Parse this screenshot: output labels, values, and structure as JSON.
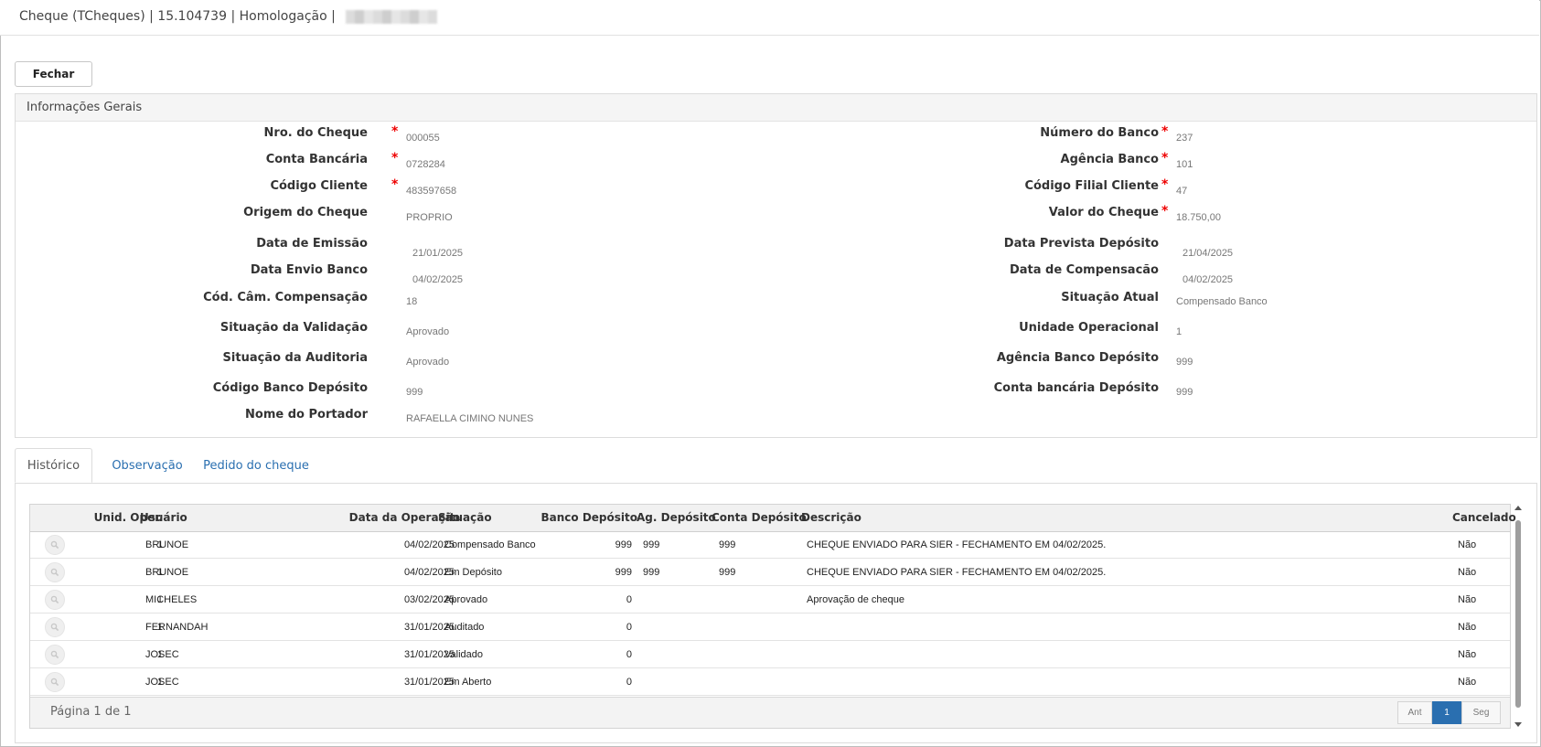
{
  "window": {
    "title": "Cheque (TCheques) | 15.104739 | Homologação |"
  },
  "toolbar": {
    "close_label": "Fechar"
  },
  "general": {
    "section_title": "Informações Gerais",
    "fields": {
      "nro_cheque": {
        "label": "Nro. do Cheque",
        "value": "000055",
        "required": true
      },
      "numero_banco": {
        "label": "Número do Banco",
        "value": "237",
        "required": true
      },
      "conta_bancaria": {
        "label": "Conta Bancária",
        "value": "0728284",
        "required": true
      },
      "agencia_banco": {
        "label": "Agência Banco",
        "value": "101",
        "required": true
      },
      "codigo_cliente": {
        "label": "Código Cliente",
        "value": "483597658",
        "required": true
      },
      "codigo_filial_cliente": {
        "label": "Código Filial Cliente",
        "value": "47",
        "required": true
      },
      "origem_cheque": {
        "label": "Origem do Cheque",
        "value": "PROPRIO"
      },
      "valor_cheque": {
        "label": "Valor do Cheque",
        "value": "18.750,00",
        "required": true
      },
      "data_emissao": {
        "label": "Data de Emissão",
        "value": "21/01/2025"
      },
      "data_prevista_deposito": {
        "label": "Data Prevista Depósito",
        "value": "21/04/2025"
      },
      "data_envio_banco": {
        "label": "Data Envio Banco",
        "value": "04/02/2025"
      },
      "data_compensacao": {
        "label": "Data de Compensacão",
        "value": "04/02/2025"
      },
      "cod_cam_compensacao": {
        "label": "Cód. Câm. Compensação",
        "value": "18"
      },
      "situacao_atual": {
        "label": "Situação Atual",
        "value": "Compensado Banco"
      },
      "situacao_validacao": {
        "label": "Situação da Validação",
        "value": "Aprovado"
      },
      "unidade_operacional": {
        "label": "Unidade Operacional",
        "value": "1"
      },
      "situacao_auditoria": {
        "label": "Situação da Auditoria",
        "value": "Aprovado"
      },
      "agencia_banco_deposito": {
        "label": "Agência Banco Depósito",
        "value": "999"
      },
      "codigo_banco_deposito": {
        "label": "Código Banco Depósito",
        "value": "999"
      },
      "conta_bancaria_deposito": {
        "label": "Conta bancária Depósito",
        "value": "999"
      },
      "nome_portador": {
        "label": "Nome do Portador",
        "value": "RAFAELLA CIMINO NUNES"
      }
    }
  },
  "tabs": [
    {
      "label": "Histórico",
      "active": true
    },
    {
      "label": "Observação",
      "active": false
    },
    {
      "label": "Pedido do cheque",
      "active": false
    }
  ],
  "history": {
    "columns": {
      "unid": "Unid. Oper.",
      "usuario": "Usuário",
      "data": "Data da Operação",
      "situacao": "Situação",
      "banco": "Banco Depósito",
      "ag": "Ag. Depósito",
      "conta": "Conta Depósito",
      "descricao": "Descrição",
      "cancelado": "Cancelado"
    },
    "rows": [
      {
        "unid": "1",
        "usuario": "BRUNOE",
        "data": "04/02/2025",
        "situacao": "Compensado Banco",
        "banco": "999",
        "ag": "999",
        "conta": "999",
        "descricao": "CHEQUE ENVIADO PARA SIER - FECHAMENTO EM 04/02/2025.",
        "cancelado": "Não"
      },
      {
        "unid": "1",
        "usuario": "BRUNOE",
        "data": "04/02/2025",
        "situacao": "Em Depósito",
        "banco": "999",
        "ag": "999",
        "conta": "999",
        "descricao": "CHEQUE ENVIADO PARA SIER - FECHAMENTO EM 04/02/2025.",
        "cancelado": "Não"
      },
      {
        "unid": "1",
        "usuario": "MICHELES",
        "data": "03/02/2025",
        "situacao": "Aprovado",
        "banco": "0",
        "ag": "",
        "conta": "",
        "descricao": "Aprovação de cheque",
        "cancelado": "Não"
      },
      {
        "unid": "1",
        "usuario": "FERNANDAH",
        "data": "31/01/2025",
        "situacao": "Auditado",
        "banco": "0",
        "ag": "",
        "conta": "",
        "descricao": "",
        "cancelado": "Não"
      },
      {
        "unid": "1",
        "usuario": "JOSEC",
        "data": "31/01/2025",
        "situacao": "Validado",
        "banco": "0",
        "ag": "",
        "conta": "",
        "descricao": "",
        "cancelado": "Não"
      },
      {
        "unid": "1",
        "usuario": "JOSEC",
        "data": "31/01/2025",
        "situacao": "Em Aberto",
        "banco": "0",
        "ag": "",
        "conta": "",
        "descricao": "",
        "cancelado": "Não"
      }
    ],
    "footer": {
      "page_info": "Página 1 de 1",
      "prev_label": "Ant",
      "current_page": "1",
      "next_label": "Seg"
    }
  },
  "colors": {
    "accent": "#2a6fb0",
    "required": "#e00000"
  }
}
